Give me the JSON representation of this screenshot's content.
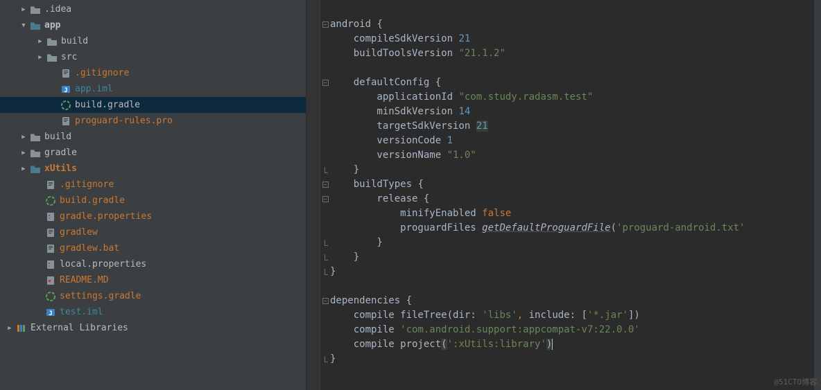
{
  "watermark": "@51CTO博客",
  "tree": [
    {
      "indent": 28,
      "arrow": "right",
      "icon": "folder",
      "label": ".idea",
      "color": "plain"
    },
    {
      "indent": 28,
      "arrow": "down",
      "icon": "module",
      "label": "app",
      "color": "plain",
      "bold": true
    },
    {
      "indent": 52,
      "arrow": "right",
      "icon": "folder",
      "label": "build",
      "color": "plain"
    },
    {
      "indent": 52,
      "arrow": "right",
      "icon": "folder",
      "label": "src",
      "color": "plain"
    },
    {
      "indent": 72,
      "arrow": "",
      "icon": "file",
      "label": ".gitignore",
      "color": "orange"
    },
    {
      "indent": 72,
      "arrow": "",
      "icon": "iml",
      "label": "app.iml",
      "color": "teal"
    },
    {
      "indent": 72,
      "arrow": "",
      "icon": "gradle",
      "label": "build.gradle",
      "color": "plain",
      "selected": true
    },
    {
      "indent": 72,
      "arrow": "",
      "icon": "file",
      "label": "proguard-rules.pro",
      "color": "orange"
    },
    {
      "indent": 28,
      "arrow": "right",
      "icon": "folder",
      "label": "build",
      "color": "plain"
    },
    {
      "indent": 28,
      "arrow": "right",
      "icon": "folder",
      "label": "gradle",
      "color": "plain"
    },
    {
      "indent": 28,
      "arrow": "right",
      "icon": "module",
      "label": "xUtils",
      "color": "orange",
      "bold": true
    },
    {
      "indent": 50,
      "arrow": "",
      "icon": "file",
      "label": ".gitignore",
      "color": "orange"
    },
    {
      "indent": 50,
      "arrow": "",
      "icon": "gradle",
      "label": "build.gradle",
      "color": "orange"
    },
    {
      "indent": 50,
      "arrow": "",
      "icon": "prop",
      "label": "gradle.properties",
      "color": "orange"
    },
    {
      "indent": 50,
      "arrow": "",
      "icon": "file",
      "label": "gradlew",
      "color": "orange"
    },
    {
      "indent": 50,
      "arrow": "",
      "icon": "file",
      "label": "gradlew.bat",
      "color": "orange"
    },
    {
      "indent": 50,
      "arrow": "",
      "icon": "prop",
      "label": "local.properties",
      "color": "plain"
    },
    {
      "indent": 50,
      "arrow": "",
      "icon": "md",
      "label": "README.MD",
      "color": "orange"
    },
    {
      "indent": 50,
      "arrow": "",
      "icon": "gradle",
      "label": "settings.gradle",
      "color": "orange"
    },
    {
      "indent": 50,
      "arrow": "",
      "icon": "iml",
      "label": "test.iml",
      "color": "teal"
    },
    {
      "indent": 8,
      "arrow": "right",
      "icon": "lib",
      "label": "External Libraries",
      "color": "plain"
    }
  ],
  "code_lines": [
    {
      "fold": "",
      "segs": [
        [
          "",
          ""
        ]
      ]
    },
    {
      "fold": "open",
      "segs": [
        [
          "android ",
          "k"
        ],
        [
          "{",
          "k"
        ]
      ]
    },
    {
      "fold": "",
      "segs": [
        [
          "    compileSdkVersion ",
          "k"
        ],
        [
          "21",
          "num"
        ]
      ]
    },
    {
      "fold": "",
      "segs": [
        [
          "    buildToolsVersion ",
          "k"
        ],
        [
          "\"21.1.2\"",
          "str"
        ]
      ]
    },
    {
      "fold": "",
      "segs": [
        [
          "",
          ""
        ]
      ]
    },
    {
      "fold": "open",
      "segs": [
        [
          "    defaultConfig ",
          "k"
        ],
        [
          "{",
          "k"
        ]
      ]
    },
    {
      "fold": "",
      "segs": [
        [
          "        applicationId ",
          "k"
        ],
        [
          "\"com.study.radasm.test\"",
          "str"
        ]
      ]
    },
    {
      "fold": "",
      "segs": [
        [
          "        minSdkVersion ",
          "k"
        ],
        [
          "14",
          "num"
        ]
      ]
    },
    {
      "fold": "",
      "segs": [
        [
          "        targetSdkVersion ",
          "k"
        ],
        [
          "21",
          "num hl"
        ]
      ]
    },
    {
      "fold": "",
      "segs": [
        [
          "        versionCode ",
          "k"
        ],
        [
          "1",
          "num"
        ]
      ]
    },
    {
      "fold": "",
      "segs": [
        [
          "        versionName ",
          "k"
        ],
        [
          "\"1.0\"",
          "str"
        ]
      ]
    },
    {
      "fold": "close",
      "segs": [
        [
          "    }",
          "k"
        ]
      ]
    },
    {
      "fold": "open",
      "segs": [
        [
          "    buildTypes ",
          "k"
        ],
        [
          "{",
          "k"
        ]
      ]
    },
    {
      "fold": "open",
      "segs": [
        [
          "        release ",
          "k"
        ],
        [
          "{",
          "k"
        ]
      ]
    },
    {
      "fold": "",
      "segs": [
        [
          "            minifyEnabled ",
          "k"
        ],
        [
          "false",
          "kw"
        ]
      ]
    },
    {
      "fold": "",
      "segs": [
        [
          "            proguardFiles ",
          "k"
        ],
        [
          "getDefaultProguardFile",
          "fn"
        ],
        [
          "(",
          "k"
        ],
        [
          "'proguard-android.txt'",
          "str"
        ]
      ]
    },
    {
      "fold": "close",
      "segs": [
        [
          "        }",
          "k"
        ]
      ]
    },
    {
      "fold": "close",
      "segs": [
        [
          "    }",
          "k"
        ]
      ]
    },
    {
      "fold": "close",
      "segs": [
        [
          "}",
          "k"
        ]
      ]
    },
    {
      "fold": "",
      "segs": [
        [
          "",
          ""
        ]
      ]
    },
    {
      "fold": "open",
      "segs": [
        [
          "dependencies ",
          "k"
        ],
        [
          "{",
          "k"
        ]
      ]
    },
    {
      "fold": "",
      "segs": [
        [
          "    compile fileTree(",
          "k"
        ],
        [
          "dir",
          "k"
        ],
        [
          ": ",
          "k"
        ],
        [
          "'libs'",
          "str"
        ],
        [
          ", ",
          "kw"
        ],
        [
          "include",
          "k"
        ],
        [
          ": [",
          "k"
        ],
        [
          "'*.jar'",
          "str"
        ],
        [
          "])",
          "k"
        ]
      ]
    },
    {
      "fold": "",
      "segs": [
        [
          "    compile ",
          "k"
        ],
        [
          "'com.android.support:appcompat-v7:22.0.0'",
          "str"
        ]
      ]
    },
    {
      "fold": "",
      "segs": [
        [
          "    compile project",
          "k"
        ],
        [
          "(",
          "hl"
        ],
        [
          "':xUtils:library'",
          "str"
        ],
        [
          ")",
          "hl"
        ],
        [
          "",
          "cursor"
        ]
      ]
    },
    {
      "fold": "close",
      "segs": [
        [
          "}",
          "k"
        ]
      ]
    }
  ]
}
